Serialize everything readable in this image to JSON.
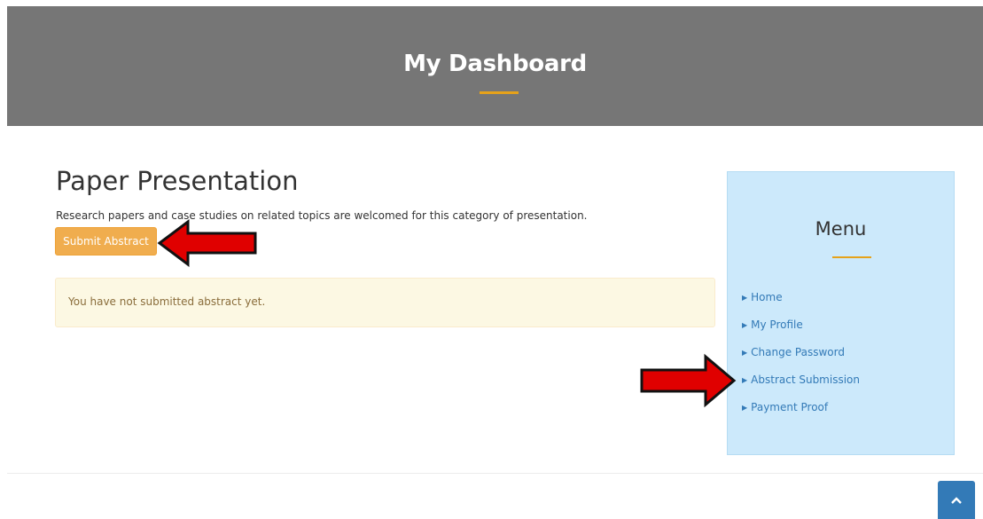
{
  "header": {
    "title": "My Dashboard",
    "accent_color": "#e6a21a",
    "background": "#767676"
  },
  "main": {
    "title": "Paper Presentation",
    "description": "Research papers and case studies on related topics are welcomed for this category of presentation.",
    "submit_button": "Submit Abstract",
    "notice": "You have not submitted abstract yet."
  },
  "menu": {
    "title": "Menu",
    "items": [
      {
        "label": "Home",
        "icon": "caret-right-icon"
      },
      {
        "label": "My Profile",
        "icon": "caret-right-icon"
      },
      {
        "label": "Change Password",
        "icon": "caret-right-icon"
      },
      {
        "label": "Abstract Submission",
        "icon": "caret-right-icon"
      },
      {
        "label": "Payment Proof",
        "icon": "caret-right-icon"
      }
    ]
  },
  "scroll_top": {
    "icon": "chevron-up-icon"
  },
  "annotations": {
    "arrow_color": "#e00000"
  }
}
